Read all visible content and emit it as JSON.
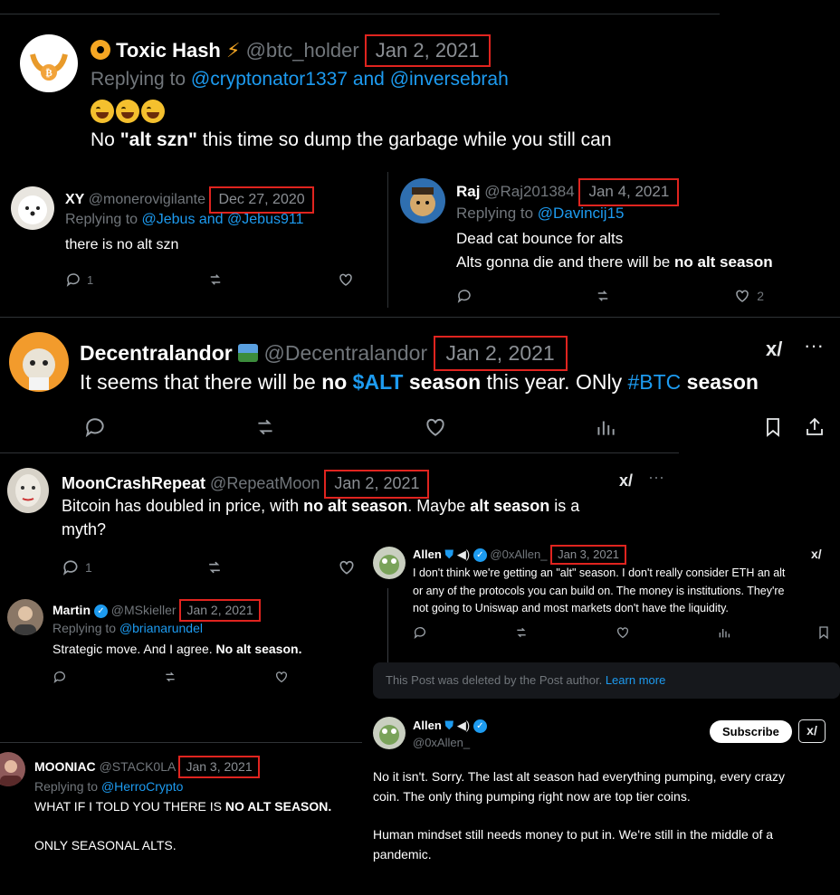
{
  "tweet1": {
    "name": "Toxic Hash",
    "handle": "@btc_holder",
    "date": "Jan 2, 2021",
    "replying_prefix": "Replying to",
    "replying_to": "@cryptonator1337 and @inversebrah",
    "text_pre": "No ",
    "text_bold": "\"alt szn\"",
    "text_post": " this time so dump the garbage while you still can"
  },
  "tweet2": {
    "name": "XY",
    "handle": "@monerovigilante",
    "date": "Dec 27, 2020",
    "replying_prefix": "Replying to",
    "replying_to": "@Jebus and @Jebus911",
    "text": "there is no alt szn",
    "reply_count": "1"
  },
  "tweet3": {
    "name": "Raj",
    "handle": "@Raj201384",
    "date": "Jan 4, 2021",
    "replying_prefix": "Replying to",
    "replying_to": "@Davincij15",
    "line1": "Dead cat bounce for alts",
    "line2_pre": "Alts gonna die and there will be ",
    "line2_bold": "no alt season",
    "like_count": "2"
  },
  "tweet4": {
    "name": "Decentralandor",
    "handle": "@Decentralandor",
    "date": "Jan 2, 2021",
    "t1": "It seems that there will be ",
    "t2": "no",
    "t3": " $ALT",
    "t4": " season",
    "t5": " this year. ONly ",
    "t6": "#BTC",
    "t7": " season"
  },
  "tweet5": {
    "name": "MoonCrashRepeat",
    "handle": "@RepeatMoon",
    "date": "Jan 2, 2021",
    "t1": "Bitcoin has doubled in price, with ",
    "t2": "no alt season",
    "t3": ". Maybe ",
    "t4": "alt season",
    "t5": " is a",
    "t6": "myth?",
    "reply_count": "1"
  },
  "tweet6": {
    "name": "Allen",
    "handle": "@0xAllen_",
    "date": "Jan 3, 2021",
    "line1": "I don't think we're getting an \"alt\" season. I don't really consider ETH an alt",
    "line2": "or any of the protocols you can build on. The money is institutions. They're",
    "line3": "not going to Uniswap and most markets don't have the liquidity."
  },
  "deleted_notice": {
    "text": "This Post was deleted by the Post author.",
    "link": "Learn more"
  },
  "tweet7": {
    "name": "Martin",
    "handle": "@MSkieller",
    "date": "Jan 2, 2021",
    "replying_prefix": "Replying to",
    "replying_to": "@brianarundel",
    "t1": "Strategic move. And I agree. ",
    "t2": "No alt season."
  },
  "tweet8": {
    "name": "Allen",
    "handle": "@0xAllen_",
    "subscribe_label": "Subscribe",
    "p1_line1": "No it isn't. Sorry. The last alt season had everything pumping, every crazy",
    "p1_line2": "coin. The only thing pumping right now are top tier coins.",
    "p2_line1": "Human mindset still needs money to put in. We're still in the middle of a",
    "p2_line2": "pandemic."
  },
  "tweet9": {
    "name": "MOONIAC",
    "handle": "@STACK0LA",
    "date": "Jan 3, 2021",
    "replying_prefix": "Replying to",
    "replying_to": "@HerroCrypto",
    "t1": "WHAT IF I TOLD YOU THERE IS ",
    "t2": "NO ALT SEASON.",
    "t3": "ONLY SEASONAL ALTS."
  },
  "colors": {
    "accent": "#1d9bf0",
    "highlight_box": "#e0241f",
    "muted": "#71767b"
  }
}
